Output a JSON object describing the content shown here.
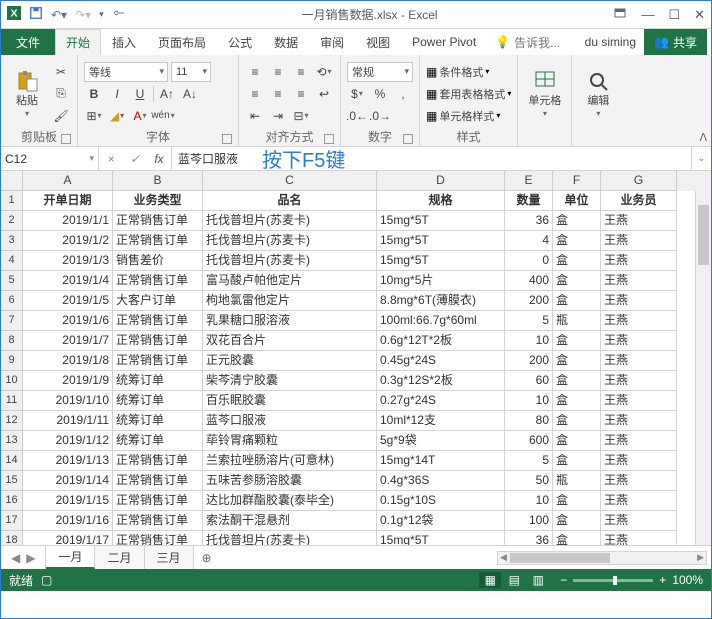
{
  "title": "一月销售数据.xlsx - Excel",
  "tabs": {
    "file": "文件",
    "home": "开始",
    "insert": "插入",
    "layout": "页面布局",
    "formulas": "公式",
    "data": "数据",
    "review": "审阅",
    "view": "视图",
    "pivot": "Power Pivot"
  },
  "tell": "告诉我...",
  "user": "du siming",
  "share": "共享",
  "groups": {
    "clipboard": "剪贴板",
    "font": "字体",
    "alignment": "对齐方式",
    "number": "数字",
    "styles": "样式",
    "cells": "单元格",
    "editing": "编辑"
  },
  "btns": {
    "paste": "粘贴",
    "cells": "单元格",
    "editing": "编辑",
    "condformat": "条件格式",
    "tableformat": "套用表格格式",
    "cellstyle": "单元格样式"
  },
  "font": {
    "name": "等线",
    "size": "11"
  },
  "numfmt": "常规",
  "namebox": "C12",
  "formula_value": "蓝芩口服液",
  "annotation": "按下F5键",
  "cols": [
    "A",
    "B",
    "C",
    "D",
    "E",
    "F",
    "G"
  ],
  "headers": [
    "开单日期",
    "业务类型",
    "品名",
    "规格",
    "数量",
    "单位",
    "业务员"
  ],
  "rows": [
    [
      "2019/1/1",
      "正常销售订单",
      "托伐普坦片(苏麦卡)",
      "15mg*5T",
      "36",
      "盒",
      "王燕"
    ],
    [
      "2019/1/2",
      "正常销售订单",
      "托伐普坦片(苏麦卡)",
      "15mg*5T",
      "4",
      "盒",
      "王燕"
    ],
    [
      "2019/1/3",
      "销售差价",
      "托伐普坦片(苏麦卡)",
      "15mg*5T",
      "0",
      "盒",
      "王燕"
    ],
    [
      "2019/1/4",
      "正常销售订单",
      "富马酸卢帕他定片",
      "10mg*5片",
      "400",
      "盒",
      "王燕"
    ],
    [
      "2019/1/5",
      "大客户订单",
      "枸地氯雷他定片",
      "8.8mg*6T(薄膜衣)",
      "200",
      "盒",
      "王燕"
    ],
    [
      "2019/1/6",
      "正常销售订单",
      "乳果糖口服溶液",
      "100ml:66.7g*60ml",
      "5",
      "瓶",
      "王燕"
    ],
    [
      "2019/1/7",
      "正常销售订单",
      "双花百合片",
      "0.6g*12T*2板",
      "10",
      "盒",
      "王燕"
    ],
    [
      "2019/1/8",
      "正常销售订单",
      "正元胶囊",
      "0.45g*24S",
      "200",
      "盒",
      "王燕"
    ],
    [
      "2019/1/9",
      "统筹订单",
      "柴芩清宁胶囊",
      "0.3g*12S*2板",
      "60",
      "盒",
      "王燕"
    ],
    [
      "2019/1/10",
      "统筹订单",
      "百乐眠胶囊",
      "0.27g*24S",
      "10",
      "盒",
      "王燕"
    ],
    [
      "2019/1/11",
      "统筹订单",
      "蓝芩口服液",
      "10ml*12支",
      "80",
      "盒",
      "王燕"
    ],
    [
      "2019/1/12",
      "统筹订单",
      "荜铃胃痛颗粒",
      "5g*9袋",
      "600",
      "盒",
      "王燕"
    ],
    [
      "2019/1/13",
      "正常销售订单",
      "兰索拉唑肠溶片(可意林)",
      "15mg*14T",
      "5",
      "盒",
      "王燕"
    ],
    [
      "2019/1/14",
      "正常销售订单",
      "五味苦参肠溶胶囊",
      "0.4g*36S",
      "50",
      "瓶",
      "王燕"
    ],
    [
      "2019/1/15",
      "正常销售订单",
      "达比加群酯胶囊(泰毕全)",
      "0.15g*10S",
      "10",
      "盒",
      "王燕"
    ],
    [
      "2019/1/16",
      "正常销售订单",
      "索法酮干混悬剂",
      "0.1g*12袋",
      "100",
      "盒",
      "王燕"
    ],
    [
      "2019/1/17",
      "正常销售订单",
      "托伐普坦片(苏麦卡)",
      "15mg*5T",
      "36",
      "盒",
      "王燕"
    ]
  ],
  "sheets": [
    "一月",
    "二月",
    "三月"
  ],
  "status": "就绪",
  "zoom": "100%"
}
